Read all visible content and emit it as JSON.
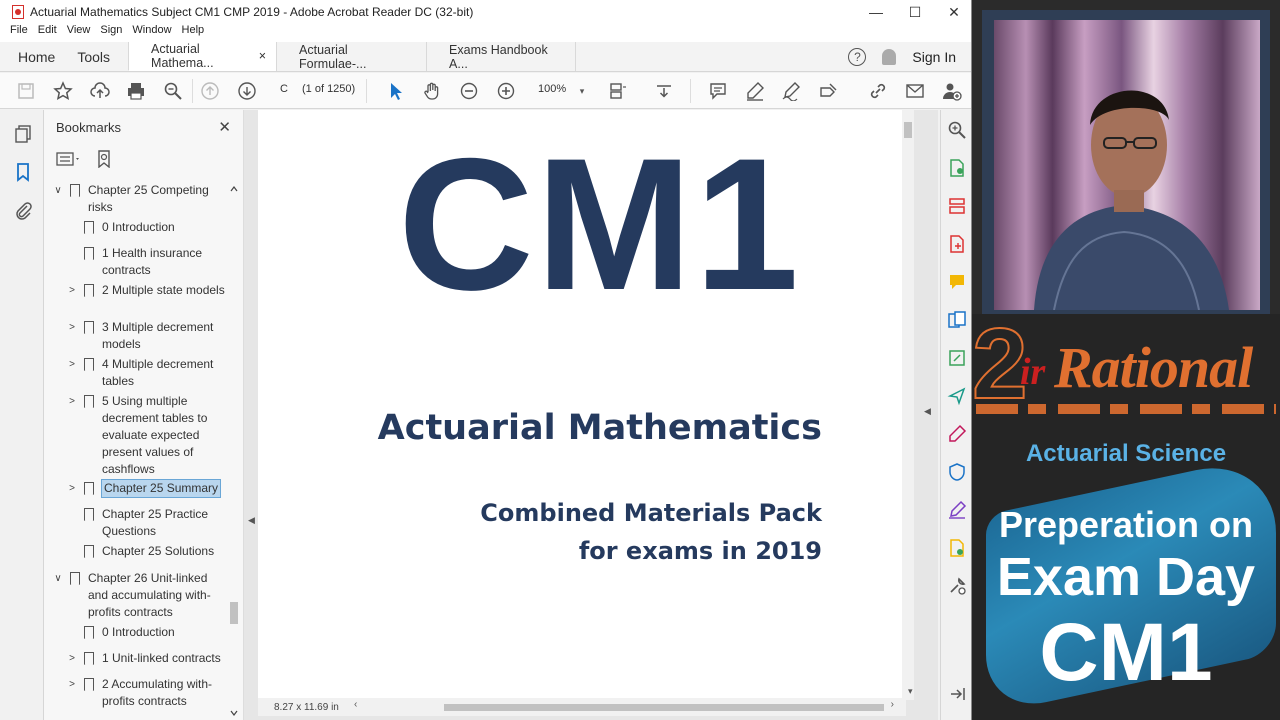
{
  "window": {
    "title": "Actuarial Mathematics Subject CM1 CMP 2019 - Adobe Acrobat Reader DC (32-bit)",
    "minimize": "—",
    "maximize": "☐",
    "close": "✕"
  },
  "menu": [
    "File",
    "Edit",
    "View",
    "Sign",
    "Window",
    "Help"
  ],
  "tabs": {
    "home": "Home",
    "tools": "Tools",
    "docs": [
      {
        "label": "Actuarial Mathema...",
        "close": "×",
        "active": true
      },
      {
        "label": "Actuarial Formulae-...",
        "active": false
      },
      {
        "label": "Exams Handbook A...",
        "active": false
      }
    ],
    "help": "?",
    "signin": "Sign In"
  },
  "toolbar": {
    "page_value": "C",
    "page_count": "(1 of 1250)",
    "zoom": "100%"
  },
  "bookmarks": {
    "title": "Bookmarks",
    "close": "✕",
    "items": [
      {
        "chev": "∨",
        "text": "Chapter 25 Competing risks",
        "level": 0
      },
      {
        "chev": "",
        "text": "0 Introduction",
        "level": 1
      },
      {
        "chev": "",
        "text": "1 Health insurance contracts",
        "level": 1
      },
      {
        "chev": ">",
        "text": "2 Multiple state models",
        "level": 1
      },
      {
        "chev": ">",
        "text": "3 Multiple decrement models",
        "level": 1
      },
      {
        "chev": ">",
        "text": "4 Multiple decrement tables",
        "level": 1
      },
      {
        "chev": ">",
        "text": "5 Using multiple decrement tables to evaluate expected present values of cashflows",
        "level": 1
      },
      {
        "chev": ">",
        "text": "Chapter 25 Summary",
        "level": 1,
        "selected": true
      },
      {
        "chev": "",
        "text": "Chapter 25 Practice Questions",
        "level": 1
      },
      {
        "chev": "",
        "text": "Chapter 25 Solutions",
        "level": 1
      },
      {
        "chev": "∨",
        "text": "Chapter 26 Unit-linked and accumulating with-profits contracts",
        "level": 0
      },
      {
        "chev": "",
        "text": "0 Introduction",
        "level": 1
      },
      {
        "chev": ">",
        "text": "1 Unit-linked contracts",
        "level": 1
      },
      {
        "chev": ">",
        "text": "2 Accumulating with-profits contracts",
        "level": 1
      }
    ]
  },
  "document": {
    "big_title": "CM1",
    "subject": "Actuarial Mathematics",
    "pack_line1": "Combined Materials Pack",
    "pack_line2": "for exams in 2019",
    "page_size": "8.27 x 11.69 in"
  },
  "overlay": {
    "logo_digit": "2",
    "logo_ir": "ir",
    "logo_word": "Rational",
    "subtitle": "Actuarial Science",
    "line1": "Preperation on",
    "line2": "Exam Day",
    "line3": "CM1"
  },
  "colors": {
    "doc_navy": "#253a5e",
    "accent_blue": "#1a73c7",
    "brand_orange": "#e07030",
    "brand_red": "#cc2020",
    "brand_sky": "#5ab2e6"
  }
}
